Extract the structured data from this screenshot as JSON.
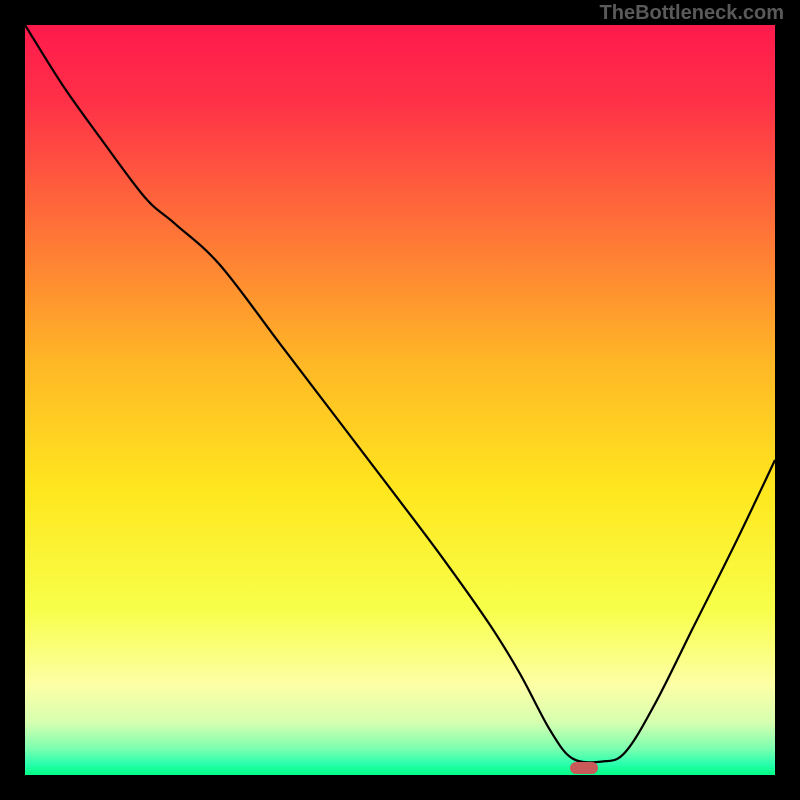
{
  "watermark": "TheBottleneck.com",
  "chart_data": {
    "type": "line",
    "title": "",
    "xlabel": "",
    "ylabel": "",
    "xlim": [
      0,
      1
    ],
    "ylim": [
      0,
      1
    ],
    "grid": false,
    "note": "Axes unlabeled; x/y expressed on 0–1 normalized plot coordinates (y=0 at bottom, y=1 at top).",
    "background": {
      "type": "vertical-gradient",
      "stops": [
        {
          "pos": 0.0,
          "color": "#ff1a4c"
        },
        {
          "pos": 0.1,
          "color": "#ff3048"
        },
        {
          "pos": 0.25,
          "color": "#ff6a3a"
        },
        {
          "pos": 0.45,
          "color": "#ffb726"
        },
        {
          "pos": 0.62,
          "color": "#ffe71e"
        },
        {
          "pos": 0.78,
          "color": "#f7ff4a"
        },
        {
          "pos": 0.88,
          "color": "#fdffa6"
        },
        {
          "pos": 0.93,
          "color": "#d6ffb0"
        },
        {
          "pos": 0.965,
          "color": "#7cffb0"
        },
        {
          "pos": 0.985,
          "color": "#2affad"
        },
        {
          "pos": 1.0,
          "color": "#00ff84"
        }
      ]
    },
    "series": [
      {
        "name": "bottleneck-curve",
        "color": "#000000",
        "x": [
          0.0,
          0.05,
          0.1,
          0.16,
          0.2,
          0.26,
          0.34,
          0.42,
          0.5,
          0.56,
          0.62,
          0.66,
          0.7,
          0.73,
          0.77,
          0.8,
          0.84,
          0.89,
          0.95,
          1.0
        ],
        "y": [
          1.0,
          0.92,
          0.85,
          0.77,
          0.735,
          0.68,
          0.575,
          0.47,
          0.365,
          0.285,
          0.2,
          0.135,
          0.06,
          0.022,
          0.018,
          0.03,
          0.095,
          0.195,
          0.315,
          0.42
        ]
      }
    ],
    "marker": {
      "x": 0.745,
      "y": 0.01,
      "color": "#c85a5a"
    }
  }
}
